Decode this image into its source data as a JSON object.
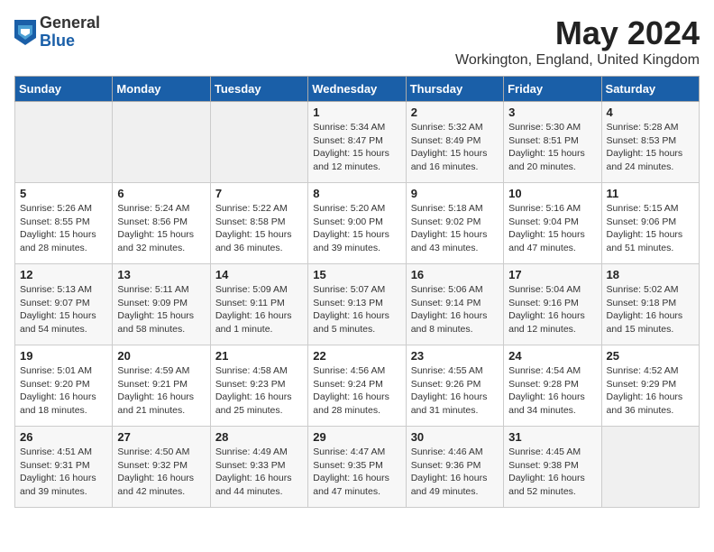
{
  "logo": {
    "general": "General",
    "blue": "Blue"
  },
  "title": {
    "month": "May 2024",
    "location": "Workington, England, United Kingdom"
  },
  "weekdays": [
    "Sunday",
    "Monday",
    "Tuesday",
    "Wednesday",
    "Thursday",
    "Friday",
    "Saturday"
  ],
  "weeks": [
    [
      {
        "day": "",
        "info": ""
      },
      {
        "day": "",
        "info": ""
      },
      {
        "day": "",
        "info": ""
      },
      {
        "day": "1",
        "info": "Sunrise: 5:34 AM\nSunset: 8:47 PM\nDaylight: 15 hours\nand 12 minutes."
      },
      {
        "day": "2",
        "info": "Sunrise: 5:32 AM\nSunset: 8:49 PM\nDaylight: 15 hours\nand 16 minutes."
      },
      {
        "day": "3",
        "info": "Sunrise: 5:30 AM\nSunset: 8:51 PM\nDaylight: 15 hours\nand 20 minutes."
      },
      {
        "day": "4",
        "info": "Sunrise: 5:28 AM\nSunset: 8:53 PM\nDaylight: 15 hours\nand 24 minutes."
      }
    ],
    [
      {
        "day": "5",
        "info": "Sunrise: 5:26 AM\nSunset: 8:55 PM\nDaylight: 15 hours\nand 28 minutes."
      },
      {
        "day": "6",
        "info": "Sunrise: 5:24 AM\nSunset: 8:56 PM\nDaylight: 15 hours\nand 32 minutes."
      },
      {
        "day": "7",
        "info": "Sunrise: 5:22 AM\nSunset: 8:58 PM\nDaylight: 15 hours\nand 36 minutes."
      },
      {
        "day": "8",
        "info": "Sunrise: 5:20 AM\nSunset: 9:00 PM\nDaylight: 15 hours\nand 39 minutes."
      },
      {
        "day": "9",
        "info": "Sunrise: 5:18 AM\nSunset: 9:02 PM\nDaylight: 15 hours\nand 43 minutes."
      },
      {
        "day": "10",
        "info": "Sunrise: 5:16 AM\nSunset: 9:04 PM\nDaylight: 15 hours\nand 47 minutes."
      },
      {
        "day": "11",
        "info": "Sunrise: 5:15 AM\nSunset: 9:06 PM\nDaylight: 15 hours\nand 51 minutes."
      }
    ],
    [
      {
        "day": "12",
        "info": "Sunrise: 5:13 AM\nSunset: 9:07 PM\nDaylight: 15 hours\nand 54 minutes."
      },
      {
        "day": "13",
        "info": "Sunrise: 5:11 AM\nSunset: 9:09 PM\nDaylight: 15 hours\nand 58 minutes."
      },
      {
        "day": "14",
        "info": "Sunrise: 5:09 AM\nSunset: 9:11 PM\nDaylight: 16 hours\nand 1 minute."
      },
      {
        "day": "15",
        "info": "Sunrise: 5:07 AM\nSunset: 9:13 PM\nDaylight: 16 hours\nand 5 minutes."
      },
      {
        "day": "16",
        "info": "Sunrise: 5:06 AM\nSunset: 9:14 PM\nDaylight: 16 hours\nand 8 minutes."
      },
      {
        "day": "17",
        "info": "Sunrise: 5:04 AM\nSunset: 9:16 PM\nDaylight: 16 hours\nand 12 minutes."
      },
      {
        "day": "18",
        "info": "Sunrise: 5:02 AM\nSunset: 9:18 PM\nDaylight: 16 hours\nand 15 minutes."
      }
    ],
    [
      {
        "day": "19",
        "info": "Sunrise: 5:01 AM\nSunset: 9:20 PM\nDaylight: 16 hours\nand 18 minutes."
      },
      {
        "day": "20",
        "info": "Sunrise: 4:59 AM\nSunset: 9:21 PM\nDaylight: 16 hours\nand 21 minutes."
      },
      {
        "day": "21",
        "info": "Sunrise: 4:58 AM\nSunset: 9:23 PM\nDaylight: 16 hours\nand 25 minutes."
      },
      {
        "day": "22",
        "info": "Sunrise: 4:56 AM\nSunset: 9:24 PM\nDaylight: 16 hours\nand 28 minutes."
      },
      {
        "day": "23",
        "info": "Sunrise: 4:55 AM\nSunset: 9:26 PM\nDaylight: 16 hours\nand 31 minutes."
      },
      {
        "day": "24",
        "info": "Sunrise: 4:54 AM\nSunset: 9:28 PM\nDaylight: 16 hours\nand 34 minutes."
      },
      {
        "day": "25",
        "info": "Sunrise: 4:52 AM\nSunset: 9:29 PM\nDaylight: 16 hours\nand 36 minutes."
      }
    ],
    [
      {
        "day": "26",
        "info": "Sunrise: 4:51 AM\nSunset: 9:31 PM\nDaylight: 16 hours\nand 39 minutes."
      },
      {
        "day": "27",
        "info": "Sunrise: 4:50 AM\nSunset: 9:32 PM\nDaylight: 16 hours\nand 42 minutes."
      },
      {
        "day": "28",
        "info": "Sunrise: 4:49 AM\nSunset: 9:33 PM\nDaylight: 16 hours\nand 44 minutes."
      },
      {
        "day": "29",
        "info": "Sunrise: 4:47 AM\nSunset: 9:35 PM\nDaylight: 16 hours\nand 47 minutes."
      },
      {
        "day": "30",
        "info": "Sunrise: 4:46 AM\nSunset: 9:36 PM\nDaylight: 16 hours\nand 49 minutes."
      },
      {
        "day": "31",
        "info": "Sunrise: 4:45 AM\nSunset: 9:38 PM\nDaylight: 16 hours\nand 52 minutes."
      },
      {
        "day": "",
        "info": ""
      }
    ]
  ]
}
